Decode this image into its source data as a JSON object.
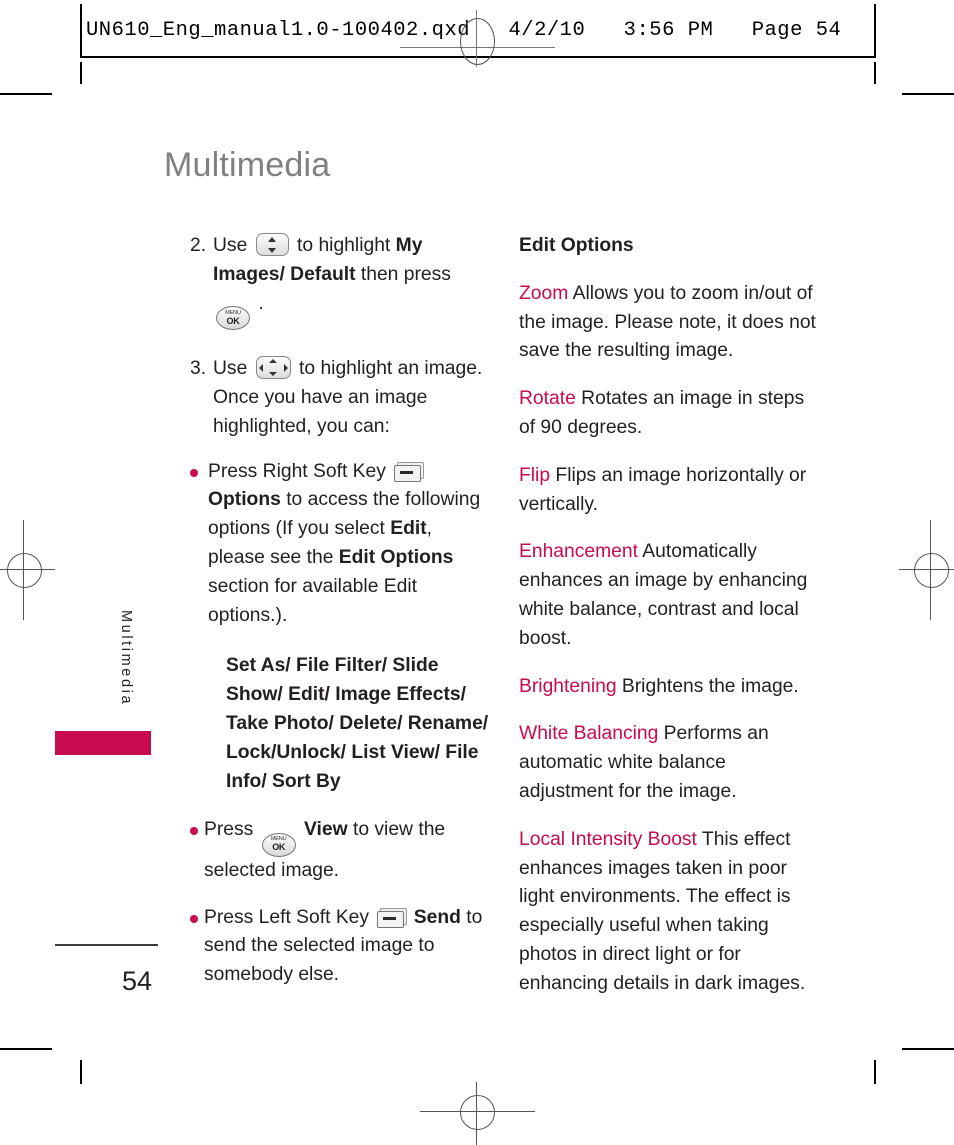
{
  "prepress": {
    "header_text": "UN610_Eng_manual1.0-100402.qxd   4/2/10   3:56 PM   Page 54"
  },
  "page": {
    "title": "Multimedia",
    "side_tab_label": "Multimedia",
    "page_number": "54",
    "accent_color": "#c80a50",
    "title_color": "#807f83"
  },
  "left_column": {
    "steps": [
      {
        "number": "2.",
        "segments": [
          {
            "text": "Use ",
            "style": "normal"
          },
          {
            "text": "nav-updown-key",
            "style": "icon"
          },
          {
            "text": " to highlight  ",
            "style": "normal"
          },
          {
            "text": "My Images/ Default",
            "style": "bold"
          },
          {
            "text": " then press ",
            "style": "normal"
          },
          {
            "text": "menu-ok-key",
            "style": "icon"
          },
          {
            "text": " .",
            "style": "normal"
          }
        ]
      },
      {
        "number": "3.",
        "segments": [
          {
            "text": "Use ",
            "style": "normal"
          },
          {
            "text": "nav-4way-key",
            "style": "icon"
          },
          {
            "text": " to highlight an image. Once you have an image highlighted, you can:",
            "style": "normal"
          }
        ]
      }
    ],
    "bullets": [
      {
        "segments": [
          {
            "text": "Press Right Soft Key ",
            "style": "normal"
          },
          {
            "text": "soft-key",
            "style": "icon"
          },
          {
            "text": " ",
            "style": "normal"
          },
          {
            "text": "Options",
            "style": "bold"
          },
          {
            "text": " to access the following options (If you select ",
            "style": "normal"
          },
          {
            "text": "Edit",
            "style": "bold"
          },
          {
            "text": ", please see the ",
            "style": "normal"
          },
          {
            "text": "Edit Options",
            "style": "bold"
          },
          {
            "text": " section for available Edit options.).",
            "style": "normal"
          }
        ]
      },
      {
        "segments": [
          {
            "text": "Press ",
            "style": "normal"
          },
          {
            "text": "menu-ok-key",
            "style": "icon"
          },
          {
            "text": " ",
            "style": "normal"
          },
          {
            "text": "View",
            "style": "bold"
          },
          {
            "text": " to view the selected image.",
            "style": "normal"
          }
        ]
      },
      {
        "segments": [
          {
            "text": "Press Left Soft Key ",
            "style": "normal"
          },
          {
            "text": "soft-key",
            "style": "icon"
          },
          {
            "text": " ",
            "style": "normal"
          },
          {
            "text": "Send",
            "style": "bold"
          },
          {
            "text": " to send the selected image to somebody else.",
            "style": "normal"
          }
        ]
      }
    ],
    "options_list": "Set As/ File Filter/ Slide Show/ Edit/ Image Effects/ Take Photo/ Delete/ Rename/ Lock/Unlock/ List View/ File Info/ Sort By"
  },
  "right_column": {
    "heading": "Edit Options",
    "entries": [
      {
        "term": "Zoom",
        "description": " Allows you to zoom in/out of the image. Please note, it does not save the resulting image."
      },
      {
        "term": "Rotate",
        "description": " Rotates an image in steps of 90 degrees."
      },
      {
        "term": "Flip",
        "description": " Flips an image horizontally or vertically."
      },
      {
        "term": "Enhancement",
        "description": " Automatically enhances an image by enhancing white balance, contrast and local boost."
      },
      {
        "term": "Brightening",
        "description": " Brightens the image."
      },
      {
        "term": "White Balancing",
        "description": " Performs an automatic white balance adjustment for the image."
      },
      {
        "term": "Local Intensity Boost",
        "description": " This effect enhances images taken in poor light environments. The effect is especially useful when taking photos in direct light or for enhancing details in dark images."
      }
    ]
  }
}
